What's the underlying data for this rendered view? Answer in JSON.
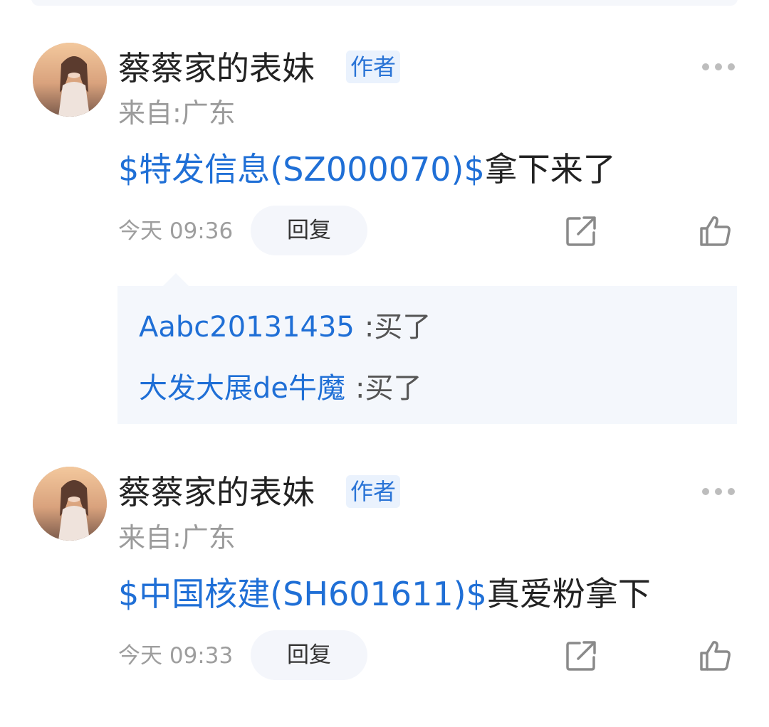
{
  "comments": [
    {
      "username": "蔡蔡家的表妹",
      "badge": "作者",
      "location": "来自:广东",
      "stock_tag": "$特发信息(SZ000070)$",
      "text": "拿下来了",
      "time": "今天 09:36",
      "reply_label": "回复",
      "replies": [
        {
          "user": "Aabc20131435",
          "sep": ":",
          "text": "买了"
        },
        {
          "user": "大发大展de牛魔",
          "sep": ":",
          "text": "买了"
        }
      ]
    },
    {
      "username": "蔡蔡家的表妹",
      "badge": "作者",
      "location": "来自:广东",
      "stock_tag": "$中国核建(SH601611)$",
      "text": "真爱粉拿下",
      "time": "今天 09:33",
      "reply_label": "回复",
      "replies": []
    }
  ],
  "icons": {
    "more": "more-dots-icon",
    "share": "share-icon",
    "like": "thumbs-up-icon"
  },
  "colors": {
    "link_blue": "#1f6fd6",
    "badge_bg": "#eaf2fd",
    "muted_gray": "#9e9e9e"
  }
}
